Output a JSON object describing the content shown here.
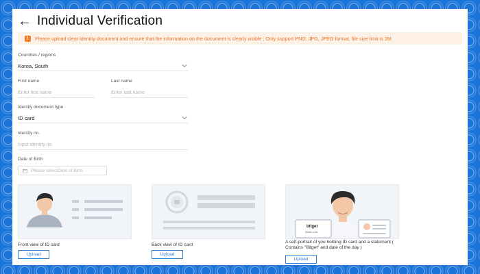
{
  "page": {
    "title": "Individual Verification",
    "notice": "Please upload clear identity document and ensure that the information on the document is clearly visible ; Only support PNG, JPG, JPEG format, file size limit is 2M"
  },
  "form": {
    "country": {
      "label": "Countries / regions",
      "value": "Korea, South"
    },
    "first_name": {
      "label": "First name",
      "placeholder": "Enter first name"
    },
    "last_name": {
      "label": "Last name",
      "placeholder": "Enter last name"
    },
    "doc_type": {
      "label": "Identity document type",
      "value": "ID card"
    },
    "identity_no": {
      "label": "Identity no.",
      "placeholder": "Input identity no."
    },
    "dob": {
      "label": "Date of Birth",
      "placeholder": "Please selectDate of Birth"
    }
  },
  "uploads": [
    {
      "caption": "Front view of ID card",
      "button": "Upload"
    },
    {
      "caption": "Back view of ID card",
      "button": "Upload"
    },
    {
      "caption": "A self-portrait of you holding ID card and a statement ( Contains \"Bitget\" and date of the day )",
      "button": "Upload",
      "card_text": "bitget",
      "card_subtext": "2023.1.23"
    }
  ],
  "colors": {
    "accent": "#2e7fd4",
    "warning": "#e8742a",
    "background": "#1a73d9"
  }
}
